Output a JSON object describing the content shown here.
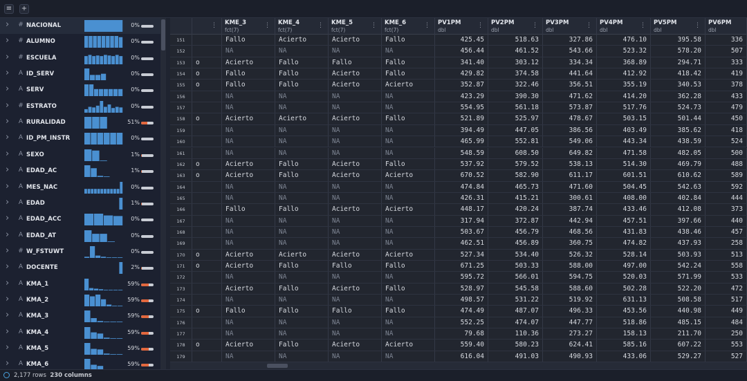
{
  "toolbar": {
    "menu_icon": "≡",
    "add_icon": "+"
  },
  "summary": [
    {
      "name": "NACIONAL",
      "type": "#",
      "pct": "0%",
      "fill": 0,
      "selected": true,
      "bars": [
        1
      ]
    },
    {
      "name": "ALUMNO",
      "type": "#",
      "pct": "0%",
      "fill": 0,
      "bars": [
        1,
        1,
        1,
        1,
        1,
        1,
        1,
        1,
        0.9
      ]
    },
    {
      "name": "ESCUELA",
      "type": "#",
      "pct": "0%",
      "fill": 0,
      "bars": [
        0.7,
        0.8,
        0.7,
        0.75,
        0.7,
        0.8,
        0.75,
        0.7,
        0.8,
        0.7
      ]
    },
    {
      "name": "ID_SERV",
      "type": "A",
      "pct": "0%",
      "fill": 0,
      "bars": [
        1,
        0.45,
        0.45,
        0.55,
        0,
        0,
        0
      ]
    },
    {
      "name": "SERV",
      "type": "A",
      "pct": "0%",
      "fill": 0,
      "bars": [
        1,
        1,
        0.6,
        0.6,
        0.6,
        0.6,
        0.6,
        0.6
      ]
    },
    {
      "name": "ESTRATO",
      "type": "#",
      "pct": "0%",
      "fill": 0,
      "bars": [
        0.3,
        0.5,
        0.45,
        0.6,
        1,
        0.5,
        0.7,
        0.4,
        0.5,
        0.45
      ]
    },
    {
      "name": "RURALIDAD",
      "type": "A",
      "pct": "51%",
      "fill": 0.51,
      "bars": [
        1,
        1,
        1,
        0,
        0
      ]
    },
    {
      "name": "ID_PM_INSTR",
      "type": "A",
      "pct": "0%",
      "fill": 0,
      "bars": [
        1,
        1,
        1,
        1,
        1,
        1
      ]
    },
    {
      "name": "SEXO",
      "type": "A",
      "pct": "1%",
      "fill": 0.05,
      "bars": [
        1,
        0.9,
        0.05,
        0,
        0
      ]
    },
    {
      "name": "EDAD_AC",
      "type": "A",
      "pct": "1%",
      "fill": 0.05,
      "bars": [
        1,
        0.75,
        0.1,
        0.05,
        0,
        0
      ]
    },
    {
      "name": "MES_NAC",
      "type": "A",
      "pct": "0%",
      "fill": 0,
      "bars": [
        0.4,
        0.4,
        0.4,
        0.4,
        0.4,
        0.4,
        0.4,
        0.4,
        0.4,
        0.4,
        0.4,
        1
      ]
    },
    {
      "name": "EDAD",
      "type": "A",
      "pct": "1%",
      "fill": 0.05,
      "bars": [
        0,
        0,
        0,
        0,
        0,
        0,
        0,
        0,
        0,
        1
      ]
    },
    {
      "name": "EDAD_ACC",
      "type": "A",
      "pct": "0%",
      "fill": 0,
      "bars": [
        1,
        1,
        0.85,
        0.8
      ]
    },
    {
      "name": "EDAD_AT",
      "type": "A",
      "pct": "0%",
      "fill": 0,
      "bars": [
        1,
        0.7,
        0.7,
        0.05,
        0
      ]
    },
    {
      "name": "W_FSTUWT",
      "type": "#",
      "pct": "0%",
      "fill": 0,
      "bars": [
        0.1,
        1,
        0.2,
        0.1,
        0.05,
        0.05,
        0.05
      ]
    },
    {
      "name": "DOCENTE",
      "type": "A",
      "pct": "2%",
      "fill": 0.08,
      "bars": [
        0,
        0,
        0,
        0,
        0,
        0,
        0,
        0,
        0,
        1
      ]
    },
    {
      "name": "KMA_1",
      "type": "A",
      "pct": "59%",
      "fill": 0.59,
      "bars": [
        1,
        0.2,
        0.15,
        0.1,
        0.05,
        0.05,
        0.05,
        0.05
      ]
    },
    {
      "name": "KMA_2",
      "type": "A",
      "pct": "59%",
      "fill": 0.59,
      "bars": [
        1,
        0.85,
        1,
        0.6,
        0.15,
        0.05,
        0.05
      ]
    },
    {
      "name": "KMA_3",
      "type": "A",
      "pct": "59%",
      "fill": 0.59,
      "bars": [
        1,
        0.35,
        0.1,
        0.05,
        0.05,
        0.05
      ]
    },
    {
      "name": "KMA_4",
      "type": "A",
      "pct": "59%",
      "fill": 0.59,
      "bars": [
        1,
        0.55,
        0.45,
        0.1,
        0.05,
        0.05
      ]
    },
    {
      "name": "KMA_5",
      "type": "A",
      "pct": "59%",
      "fill": 0.59,
      "bars": [
        1,
        0.5,
        0.45,
        0.1,
        0.05,
        0.05
      ]
    },
    {
      "name": "KMA_6",
      "type": "A",
      "pct": "59%",
      "fill": 0.59,
      "bars": [
        1,
        0.5,
        0.4,
        0.1,
        0.05,
        0.05
      ]
    }
  ],
  "columns": [
    {
      "name": "",
      "type": ""
    },
    {
      "name": "KME_3",
      "type": "fct(7)"
    },
    {
      "name": "KME_4",
      "type": "fct(7)"
    },
    {
      "name": "KME_5",
      "type": "fct(7)"
    },
    {
      "name": "KME_6",
      "type": "fct(7)"
    },
    {
      "name": "PV1PM",
      "type": "dbl"
    },
    {
      "name": "PV2PM",
      "type": "dbl"
    },
    {
      "name": "PV3PM",
      "type": "dbl"
    },
    {
      "name": "PV4PM",
      "type": "dbl"
    },
    {
      "name": "PV5PM",
      "type": "dbl"
    },
    {
      "name": "PV6PM",
      "type": "dbl"
    }
  ],
  "rows": [
    [
      "151",
      "",
      "Fallo",
      "Acierto",
      "Acierto",
      "Fallo",
      "425.45",
      "518.63",
      "327.86",
      "476.10",
      "395.58",
      "336"
    ],
    [
      "152",
      "",
      "NA",
      "NA",
      "NA",
      "NA",
      "456.44",
      "461.52",
      "543.66",
      "523.32",
      "578.20",
      "507"
    ],
    [
      "153",
      "o",
      "Acierto",
      "Fallo",
      "Fallo",
      "Fallo",
      "341.40",
      "303.12",
      "334.34",
      "368.89",
      "294.71",
      "333"
    ],
    [
      "154",
      "o",
      "Fallo",
      "Fallo",
      "Acierto",
      "Fallo",
      "429.82",
      "374.58",
      "441.64",
      "412.92",
      "418.42",
      "419"
    ],
    [
      "155",
      "o",
      "Fallo",
      "Fallo",
      "Acierto",
      "Acierto",
      "352.87",
      "322.46",
      "356.51",
      "355.19",
      "340.53",
      "378"
    ],
    [
      "156",
      "",
      "NA",
      "NA",
      "NA",
      "NA",
      "423.29",
      "390.30",
      "471.62",
      "414.20",
      "362.28",
      "433"
    ],
    [
      "157",
      "",
      "NA",
      "NA",
      "NA",
      "NA",
      "554.95",
      "561.18",
      "573.87",
      "517.76",
      "524.73",
      "479"
    ],
    [
      "158",
      "o",
      "Acierto",
      "Acierto",
      "Acierto",
      "Fallo",
      "521.89",
      "525.97",
      "478.67",
      "503.15",
      "501.44",
      "450"
    ],
    [
      "159",
      "",
      "NA",
      "NA",
      "NA",
      "NA",
      "394.49",
      "447.05",
      "386.56",
      "403.49",
      "385.62",
      "418"
    ],
    [
      "160",
      "",
      "NA",
      "NA",
      "NA",
      "NA",
      "465.99",
      "552.81",
      "549.06",
      "443.34",
      "438.59",
      "524"
    ],
    [
      "161",
      "",
      "NA",
      "NA",
      "NA",
      "NA",
      "548.59",
      "608.50",
      "649.82",
      "471.58",
      "482.05",
      "500"
    ],
    [
      "162",
      "o",
      "Acierto",
      "Fallo",
      "Acierto",
      "Fallo",
      "537.92",
      "579.52",
      "538.13",
      "514.30",
      "469.79",
      "488"
    ],
    [
      "163",
      "o",
      "Acierto",
      "Fallo",
      "Acierto",
      "Acierto",
      "670.52",
      "582.90",
      "611.17",
      "601.51",
      "610.62",
      "589"
    ],
    [
      "164",
      "",
      "NA",
      "NA",
      "NA",
      "NA",
      "474.84",
      "465.73",
      "471.60",
      "504.45",
      "542.63",
      "592"
    ],
    [
      "165",
      "",
      "NA",
      "NA",
      "NA",
      "NA",
      "426.31",
      "415.21",
      "300.61",
      "408.00",
      "402.84",
      "444"
    ],
    [
      "166",
      "",
      "Fallo",
      "Fallo",
      "Acierto",
      "Acierto",
      "448.17",
      "420.24",
      "387.74",
      "433.46",
      "412.08",
      "373"
    ],
    [
      "167",
      "",
      "NA",
      "NA",
      "NA",
      "NA",
      "317.94",
      "372.87",
      "442.94",
      "457.51",
      "397.66",
      "440"
    ],
    [
      "168",
      "",
      "NA",
      "NA",
      "NA",
      "NA",
      "503.67",
      "456.79",
      "468.56",
      "431.83",
      "438.46",
      "457"
    ],
    [
      "169",
      "",
      "NA",
      "NA",
      "NA",
      "NA",
      "462.51",
      "456.89",
      "360.75",
      "474.82",
      "437.93",
      "258"
    ],
    [
      "170",
      "o",
      "Acierto",
      "Acierto",
      "Acierto",
      "Acierto",
      "527.34",
      "534.40",
      "526.32",
      "528.14",
      "503.93",
      "513"
    ],
    [
      "171",
      "o",
      "Acierto",
      "Fallo",
      "Fallo",
      "Fallo",
      "671.25",
      "503.33",
      "588.00",
      "497.00",
      "542.24",
      "558"
    ],
    [
      "172",
      "",
      "NA",
      "NA",
      "NA",
      "NA",
      "595.72",
      "566.01",
      "594.75",
      "520.03",
      "571.99",
      "533"
    ],
    [
      "173",
      "",
      "Acierto",
      "Fallo",
      "Acierto",
      "Fallo",
      "528.97",
      "545.58",
      "588.60",
      "502.28",
      "522.20",
      "472"
    ],
    [
      "174",
      "",
      "NA",
      "NA",
      "NA",
      "NA",
      "498.57",
      "531.22",
      "519.92",
      "631.13",
      "508.58",
      "517"
    ],
    [
      "175",
      "o",
      "Fallo",
      "Fallo",
      "Fallo",
      "Fallo",
      "474.49",
      "487.07",
      "496.33",
      "453.56",
      "440.98",
      "449"
    ],
    [
      "176",
      "",
      "NA",
      "NA",
      "NA",
      "NA",
      "552.25",
      "474.07",
      "447.77",
      "518.86",
      "485.15",
      "484"
    ],
    [
      "177",
      "",
      "NA",
      "NA",
      "NA",
      "NA",
      "79.68",
      "110.36",
      "273.27",
      "158.13",
      "211.70",
      "250"
    ],
    [
      "178",
      "o",
      "Acierto",
      "Fallo",
      "Acierto",
      "Acierto",
      "559.40",
      "580.23",
      "624.41",
      "585.16",
      "607.22",
      "553"
    ],
    [
      "179",
      "",
      "NA",
      "NA",
      "NA",
      "NA",
      "616.04",
      "491.03",
      "490.93",
      "433.06",
      "529.27",
      "527"
    ]
  ],
  "status": {
    "rows": "2,177 rows",
    "columns": "230 columns"
  },
  "colors": {
    "accent_bar": "#4a90d1",
    "missing_fill": "#e2673d"
  }
}
